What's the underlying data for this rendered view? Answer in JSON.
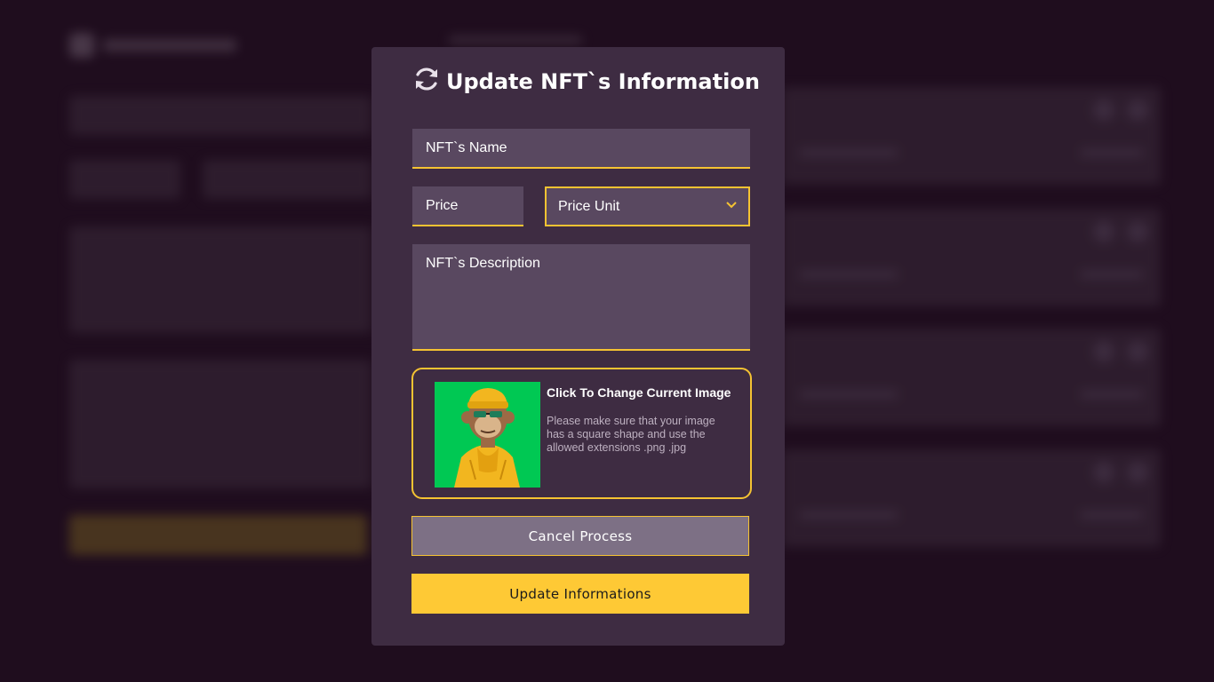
{
  "modal": {
    "title": "Update NFT`s Information",
    "name_placeholder": "NFT`s Name",
    "price_placeholder": "Price",
    "price_unit": {
      "selected": "Price Unit"
    },
    "description_placeholder": "NFT`s Description",
    "upload": {
      "title": "Click To Change Current Image",
      "description": "Please make sure that your image has a square shape and use the allowed extensions .png .jpg"
    },
    "cancel_label": "Cancel Process",
    "update_label": "Update Informations"
  },
  "icons": {
    "title": "refresh-icon",
    "dropdown": "chevron-down-icon"
  },
  "colors": {
    "accent": "#f5c332",
    "modal_bg": "#3e2c42",
    "field_bg": "#594860",
    "cancel_bg": "#7d7085",
    "update_bg": "#fec935",
    "image_bg": "#00c853"
  }
}
